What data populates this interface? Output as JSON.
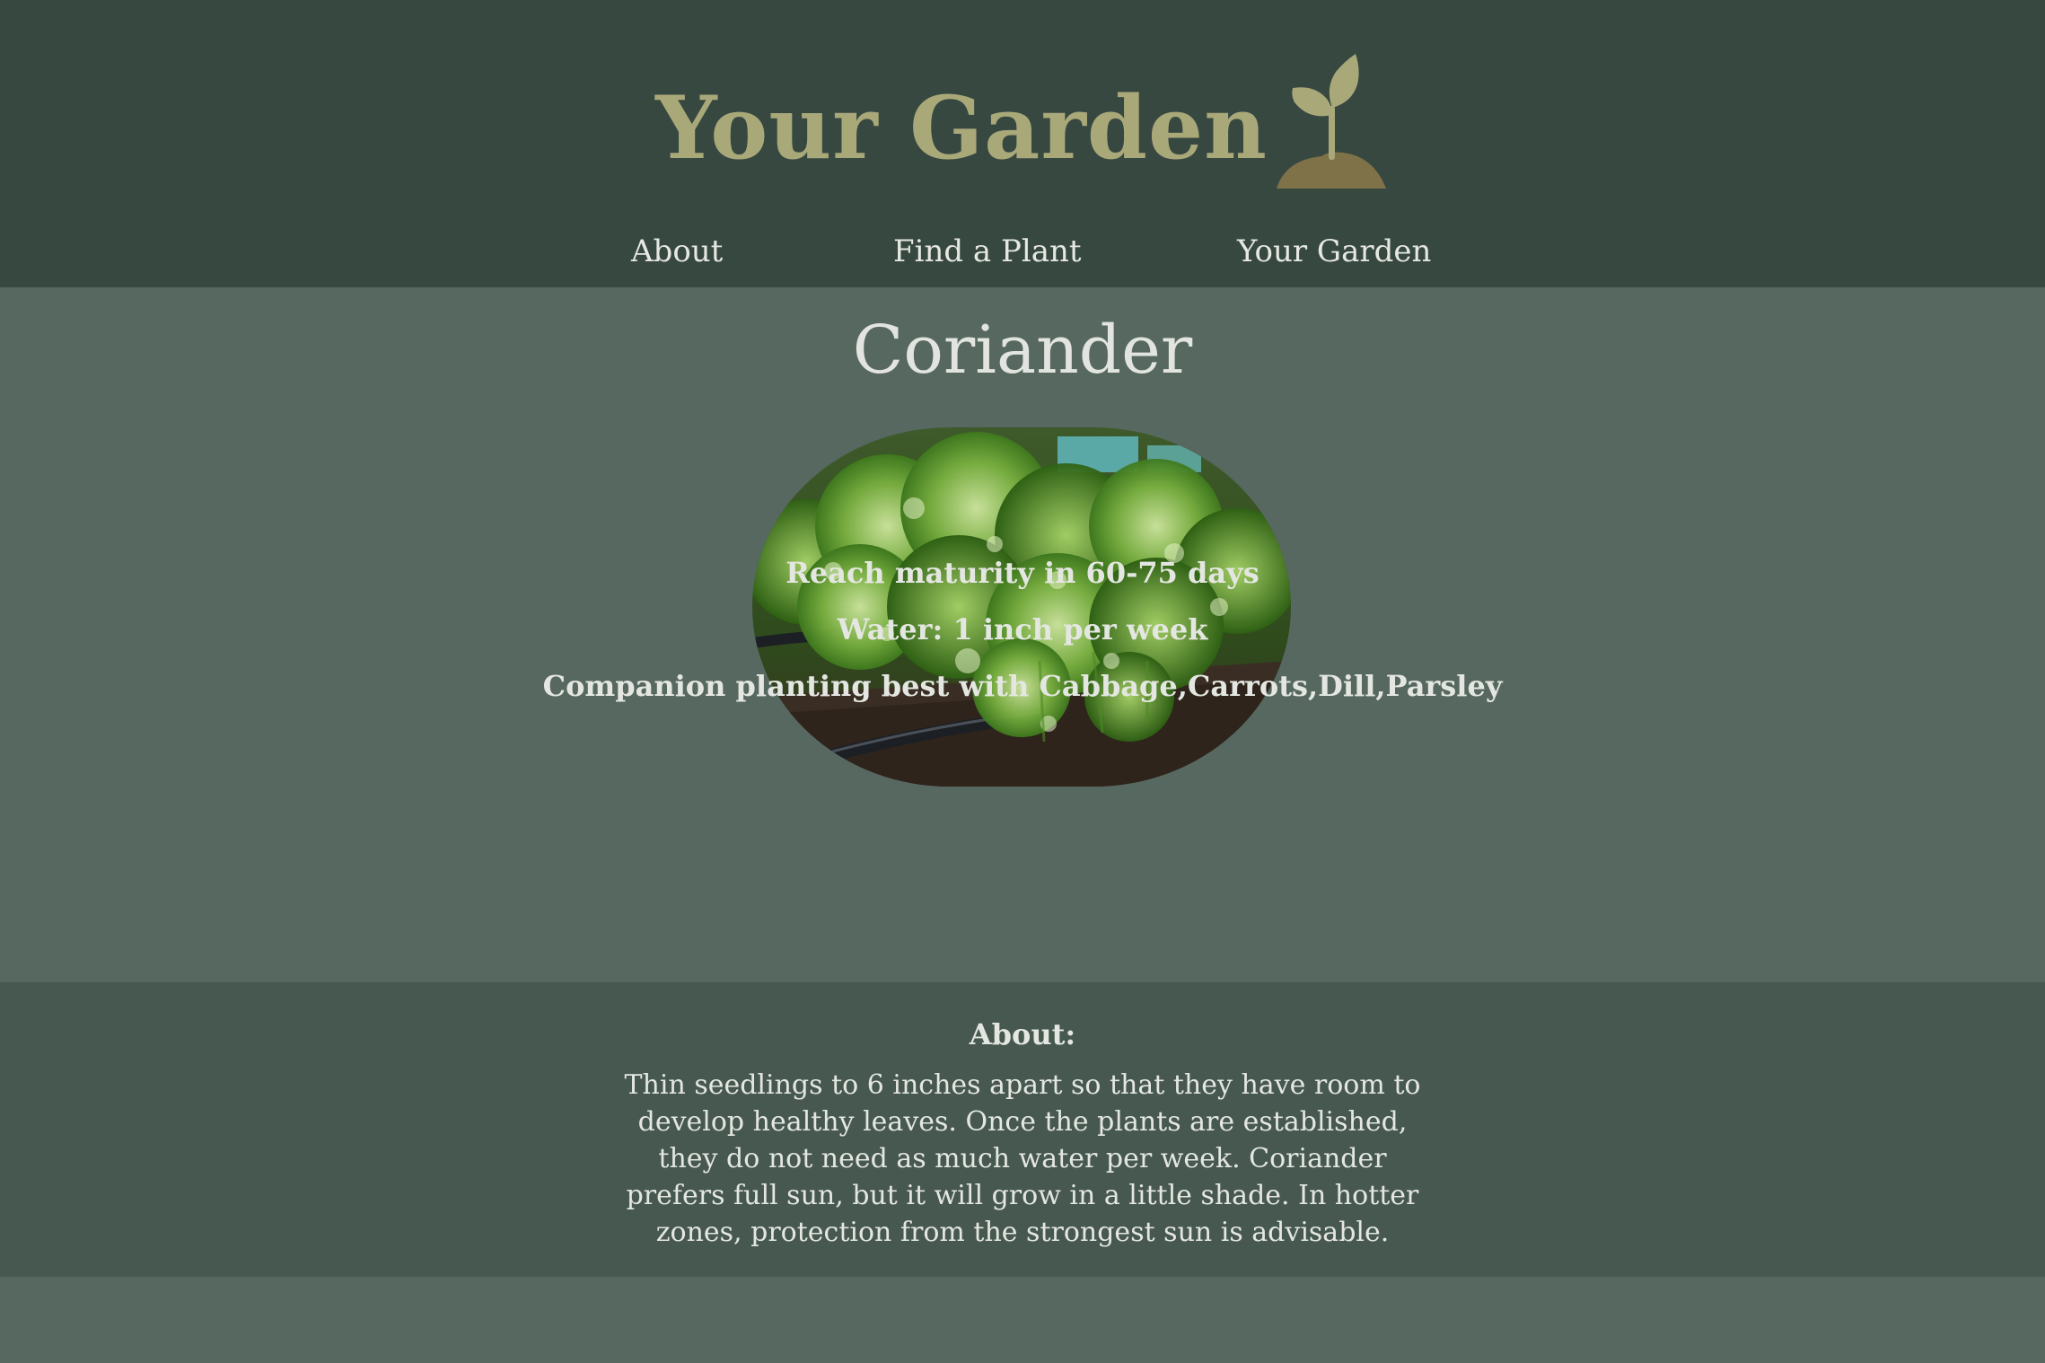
{
  "header": {
    "title": "Your Garden",
    "logo_icon": "sprout-icon",
    "title_color": "#a9a879",
    "background": "#374841"
  },
  "nav": {
    "items": [
      {
        "label": "About"
      },
      {
        "label": "Find a Plant"
      },
      {
        "label": "Your Garden"
      }
    ]
  },
  "plant": {
    "name": "Coriander",
    "image_icon": "coriander-photo",
    "facts": [
      "Reach maturity in 60-75 days",
      "Water: 1 inch per week",
      "Companion planting best with Cabbage,Carrots,Dill,Parsley"
    ]
  },
  "about": {
    "heading": "About:",
    "text": "Thin seedlings to 6 inches apart so that they have room to develop healthy leaves. Once the plants are established, they do not need as much water per week. Coriander prefers full sun, but it will grow in a little shade. In hotter zones, protection from the strongest sun is advisable."
  },
  "colors": {
    "main_background": "#566860",
    "about_background": "#465850",
    "text": "#e4e7e1"
  }
}
